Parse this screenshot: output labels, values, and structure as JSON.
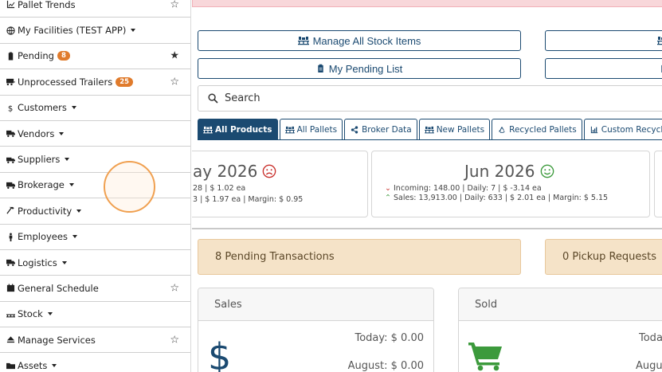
{
  "sidebar": {
    "items": [
      {
        "label": "Pallet Trends",
        "icon": "chart-line-icon",
        "star": "☆"
      },
      {
        "label": "My Facilities (TEST APP)",
        "icon": "globe-icon",
        "caret": true
      },
      {
        "label": "Pending",
        "icon": "clipboard-icon",
        "badge": "8",
        "star": "★"
      },
      {
        "label": "Unprocessed Trailers",
        "icon": "trailer-icon",
        "badge": "25",
        "star": "☆"
      },
      {
        "label": "Customers",
        "icon": "dollar-icon",
        "caret": true
      },
      {
        "label": "Vendors",
        "icon": "truck-icon",
        "caret": true
      },
      {
        "label": "Suppliers",
        "icon": "truck-loading-icon",
        "caret": true
      },
      {
        "label": "Brokerage",
        "icon": "truck-moving-icon",
        "caret": true
      },
      {
        "label": "Productivity",
        "icon": "hammer-icon",
        "caret": true
      },
      {
        "label": "Employees",
        "icon": "person-icon",
        "caret": true
      },
      {
        "label": "Logistics",
        "icon": "truck-icon",
        "caret": true
      },
      {
        "label": "General Schedule",
        "icon": "calendar-icon",
        "star": "☆"
      },
      {
        "label": "Stock",
        "icon": "pallet-icon",
        "caret": true
      },
      {
        "label": "Manage Services",
        "icon": "eject-icon",
        "star": "☆"
      },
      {
        "label": "Assets",
        "icon": "folder-icon",
        "caret": true
      }
    ]
  },
  "buttons": {
    "manage_stock": "Manage All Stock Items",
    "pending_list": "My Pending List"
  },
  "search": {
    "label": "Search"
  },
  "tabs": [
    {
      "label": "All Products",
      "active": true
    },
    {
      "label": "All Pallets"
    },
    {
      "label": "Broker Data"
    },
    {
      "label": "New Pallets"
    },
    {
      "label": "Recycled Pallets"
    },
    {
      "label": "Custom Recycled Pallets"
    }
  ],
  "months": {
    "prev": {
      "title": "ay 2026",
      "line1": "28 | $ 1.02 ea",
      "line2": "3 | $ 1.97 ea | Margin: $ 0.95"
    },
    "current": {
      "title": "Jun 2026",
      "line1": "Incoming: 148.00 | Daily: 7 | $ -3.14 ea",
      "line2": "Sales: 13,913.00 | Daily: 633 | $ 2.01 ea | Margin: $ 5.15"
    }
  },
  "pending": {
    "transactions": "8 Pending Transactions",
    "pickups": "0 Pickup Requests"
  },
  "sales_panel": {
    "title": "Sales",
    "today": "Today: $ 0.00",
    "month": "August: $ 0.00"
  },
  "sold_panel": {
    "title": "Sold",
    "today": "Toda",
    "month": "Augus"
  },
  "colors": {
    "brand": "#1b4a71",
    "badge": "#e07b2c",
    "sad_face": "#c9302c",
    "happy_face": "#3c9a3c",
    "cart": "#3c9a3c",
    "dollar": "#1b4a71"
  }
}
